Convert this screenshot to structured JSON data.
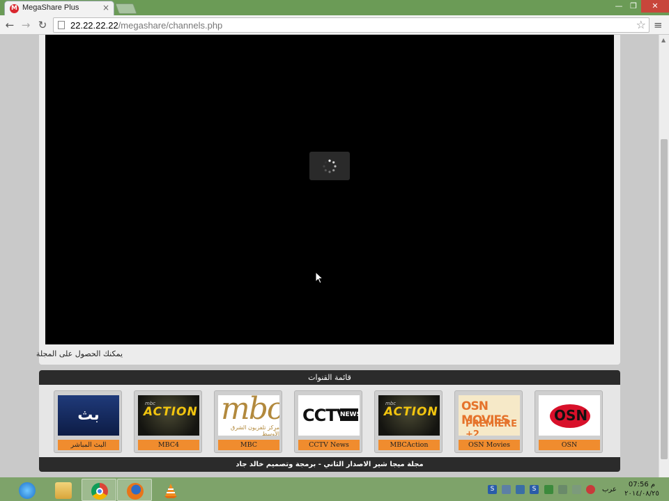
{
  "browser": {
    "tab_title": "MegaShare Plus",
    "tab_favicon_letter": "M",
    "tab_close": "×",
    "url_host": "22.22.22.22",
    "url_path": "/megashare/channels.php",
    "back": "←",
    "forward": "→",
    "reload": "↻",
    "star": "☆",
    "menu": "≡",
    "win_min": "—",
    "win_max": "❐",
    "win_close": "✕"
  },
  "player": {
    "caption": "يمكنك الحصول على المجلة"
  },
  "channels": {
    "header": "قائمة القنوات",
    "items": [
      {
        "label": "البث المباشر",
        "logo_text": "بث مباشر",
        "logo": "live"
      },
      {
        "label": "MBC4",
        "logo_text": "ACTION",
        "logo_sub": "mbc",
        "logo": "mbcaction"
      },
      {
        "label": "MBC",
        "logo_text": "mbc",
        "logo_sub": "مركز تلفزيون الشرق الأوسط",
        "logo": "mbc"
      },
      {
        "label": "CCTV News",
        "logo_text": "CCTV",
        "logo_sub": "NEWS",
        "logo": "cctv"
      },
      {
        "label": "MBCAction",
        "logo_text": "ACTION",
        "logo_sub": "mbc",
        "logo": "mbcaction"
      },
      {
        "label": "OSN Movies",
        "logo_text": "OSN MOVIES",
        "logo_sub": "PREMIERE +2",
        "logo": "osnmovies"
      },
      {
        "label": "OSN",
        "logo_text": "OSN",
        "logo": "osn"
      }
    ],
    "footer": "مجلة ميجا شير الاصدار الثاني - برمجة وتصميم خالد جاد"
  },
  "taskbar": {
    "clock_ampm": "م",
    "clock_time": "07:56",
    "clock_date": "٢٠١٤/٠٨/٢٥",
    "language": "عرب"
  },
  "colors": {
    "title_bar": "#6b9b56",
    "taskbar": "#7ea36a",
    "channel_label": "#f08c2e",
    "header_bar": "#2b2b2b"
  }
}
